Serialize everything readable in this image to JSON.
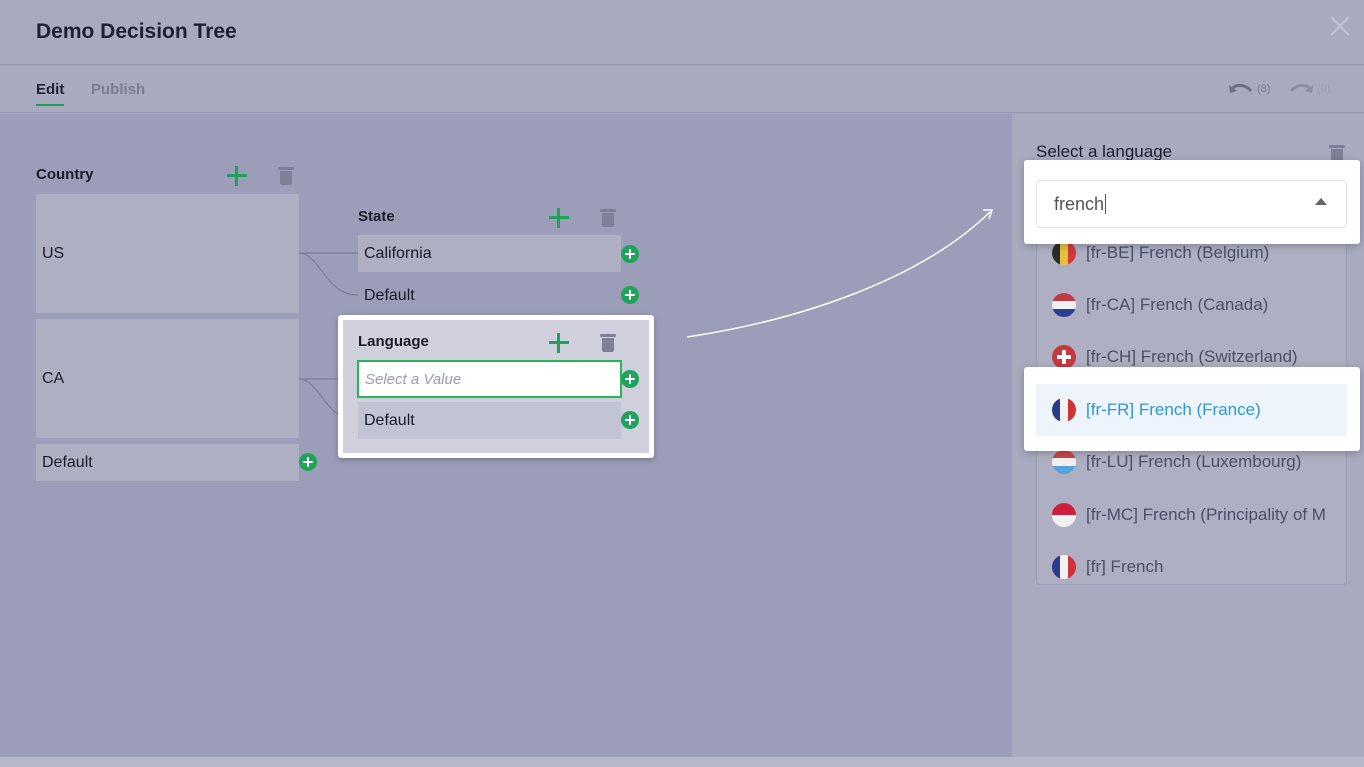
{
  "header": {
    "title": "Demo Decision Tree"
  },
  "tabs": {
    "edit": "Edit",
    "publish": "Publish"
  },
  "history": {
    "undo_count": "(8)",
    "redo_count": "(0)"
  },
  "country": {
    "title": "Country",
    "items": [
      "US",
      "CA",
      "Default"
    ]
  },
  "state": {
    "title": "State",
    "items": [
      "California",
      "Default"
    ]
  },
  "language": {
    "title": "Language",
    "placeholder": "Select a Value",
    "default": "Default"
  },
  "panel": {
    "label": "Select a language",
    "search_value": "french",
    "options": [
      "[fr-BE] French (Belgium)",
      "[fr-CA] French (Canada)",
      "[fr-CH] French (Switzerland)",
      "[fr-FR] French (France)",
      "[fr-LU] French (Luxembourg)",
      "[fr-MC] French (Principality of M",
      "[fr] French"
    ],
    "selected_option": "[fr-FR] French (France)"
  },
  "colors": {
    "accent_green": "#1ea35b",
    "selected_text": "#2d97d8"
  }
}
